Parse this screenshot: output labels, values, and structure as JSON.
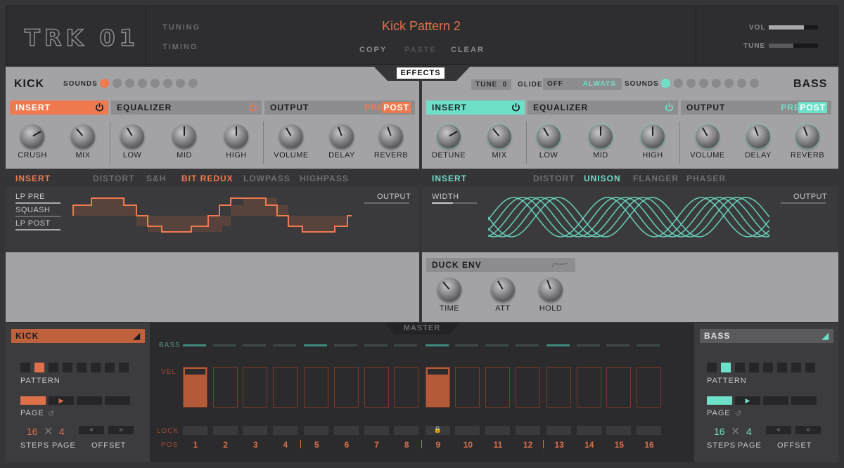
{
  "header": {
    "logo": "TRK 01",
    "menu": [
      "TUNING",
      "TIMING"
    ],
    "pattern_title": "Kick Pattern 2",
    "buttons": [
      "COPY",
      "PASTE",
      "CLEAR"
    ],
    "vol_label": "VOL",
    "tune_label": "TUNE",
    "vol_level": 0.72,
    "tune_level": 0.5
  },
  "effects_tab": "EFFECTS",
  "kick": {
    "title": "KICK",
    "sounds_label": "SOUNDS",
    "active_sound": 0,
    "sound_count": 8,
    "accent": "#f07a50",
    "sections": {
      "insert": "INSERT",
      "equalizer": "EQUALIZER",
      "output": "OUTPUT",
      "pre": "PRE",
      "post": "POST"
    },
    "knobs": [
      "CRUSH",
      "MIX",
      "LOW",
      "MID",
      "HIGH",
      "VOLUME",
      "DELAY",
      "REVERB"
    ],
    "fx": {
      "title": "INSERT",
      "tabs": [
        "DISTORT",
        "S&H",
        "BIT REDUX",
        "LOWPASS",
        "HIGHPASS"
      ],
      "active": "BIT REDUX",
      "params": [
        "LP PRE",
        "SQUASH",
        "LP POST"
      ],
      "output": "OUTPUT"
    }
  },
  "bass": {
    "title": "BASS",
    "tune_label": "TUNE",
    "tune_value": "0",
    "glide_label": "GLIDE",
    "glide_off": "OFF",
    "glide_always": "ALWAYS",
    "sounds_label": "SOUNDS",
    "active_sound": 0,
    "sound_count": 8,
    "accent": "#6fe0c8",
    "sections": {
      "insert": "INSERT",
      "equalizer": "EQUALIZER",
      "output": "OUTPUT",
      "pre": "PRE",
      "post": "POST"
    },
    "knobs": [
      "DETUNE",
      "MIX",
      "LOW",
      "MID",
      "HIGH",
      "VOLUME",
      "DELAY",
      "REVERB"
    ],
    "fx": {
      "title": "INSERT",
      "tabs": [
        "DISTORT",
        "UNISON",
        "FLANGER",
        "PHASER"
      ],
      "active": "UNISON",
      "params": [
        "WIDTH"
      ],
      "output": "OUTPUT"
    },
    "duck": {
      "title": "DUCK ENV",
      "knobs": [
        "TIME",
        "ATT",
        "HOLD"
      ]
    }
  },
  "master": "MASTER",
  "seq": {
    "bass_label": "BASS",
    "vel_label": "VEL",
    "lock_label": "LOCK",
    "pos_label": "POS",
    "positions": [
      "1",
      "2",
      "3",
      "4",
      "5",
      "6",
      "7",
      "8",
      "9",
      "10",
      "11",
      "12",
      "13",
      "14",
      "15",
      "16"
    ],
    "active_steps": [
      1,
      9
    ],
    "bass_active": [
      1,
      5,
      9,
      13
    ],
    "lock_step": 9
  },
  "kick_side": {
    "title": "KICK",
    "pattern_label": "PATTERN",
    "page_label": "PAGE",
    "steps_value": "16",
    "page_value": "4",
    "steps_label": "STEPS",
    "page_lbl": "PAGE",
    "offset_label": "OFFSET",
    "accent": "#e0704a"
  },
  "bass_side": {
    "title": "BASS",
    "pattern_label": "PATTERN",
    "page_label": "PAGE",
    "steps_value": "16",
    "page_value": "4",
    "steps_label": "STEPS",
    "page_lbl": "PAGE",
    "offset_label": "OFFSET",
    "accent": "#6fe0c8"
  }
}
